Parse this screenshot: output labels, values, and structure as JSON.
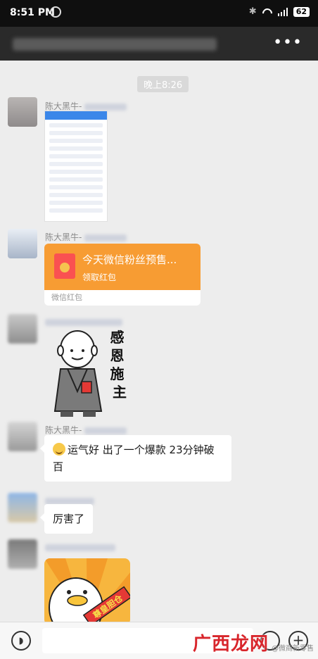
{
  "status_bar": {
    "time": "8:51 PM",
    "battery": "62"
  },
  "chat": {
    "timestamp": "晚上8:26",
    "messages": [
      {
        "sender": "陈大黑牛-"
      },
      {
        "sender": "陈大黑牛-",
        "red_packet": {
          "title": "今天微信粉丝预售...",
          "action": "领取红包",
          "footer": "微信红包"
        }
      },
      {
        "sticker_text": "感恩施主"
      },
      {
        "sender": "陈大黑牛-",
        "text": "运气好 出了一个爆款 23分钟破百"
      },
      {
        "text": "厉害了"
      },
      {
        "sticker_text": "尊皇胆仓"
      }
    ]
  },
  "watermark": {
    "brand": "广西龙网",
    "sub": "@微商新零售"
  }
}
